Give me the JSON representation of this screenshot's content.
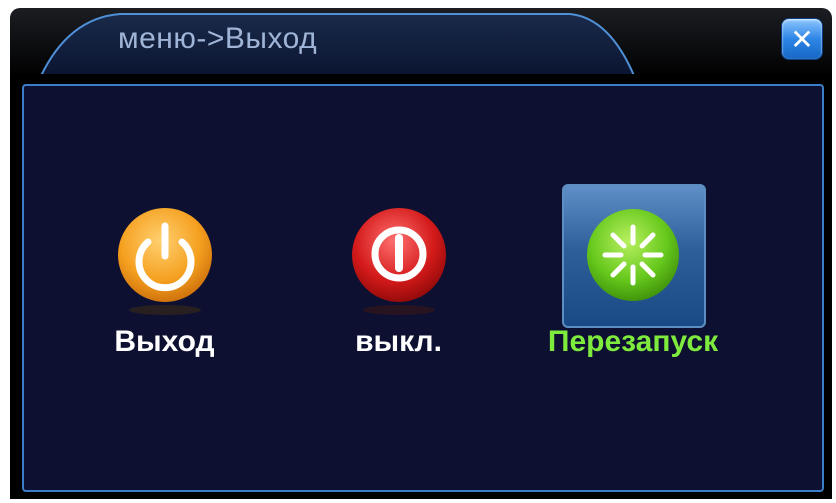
{
  "dialog": {
    "title": "меню->Выход",
    "close_icon": "close-icon"
  },
  "options": [
    {
      "label": "Выход",
      "icon": "power-icon",
      "color": "#f0a020",
      "selected": false
    },
    {
      "label": "выкл.",
      "icon": "shutdown-icon",
      "color": "#d02020",
      "selected": false
    },
    {
      "label": "Перезапуск",
      "icon": "restart-icon",
      "color": "#66c81c",
      "selected": true
    }
  ],
  "colors": {
    "panel_bg": "#0d1030",
    "border": "#3a7ec8",
    "selected_label": "#7dea3d",
    "title_text": "#9fb4d6"
  }
}
